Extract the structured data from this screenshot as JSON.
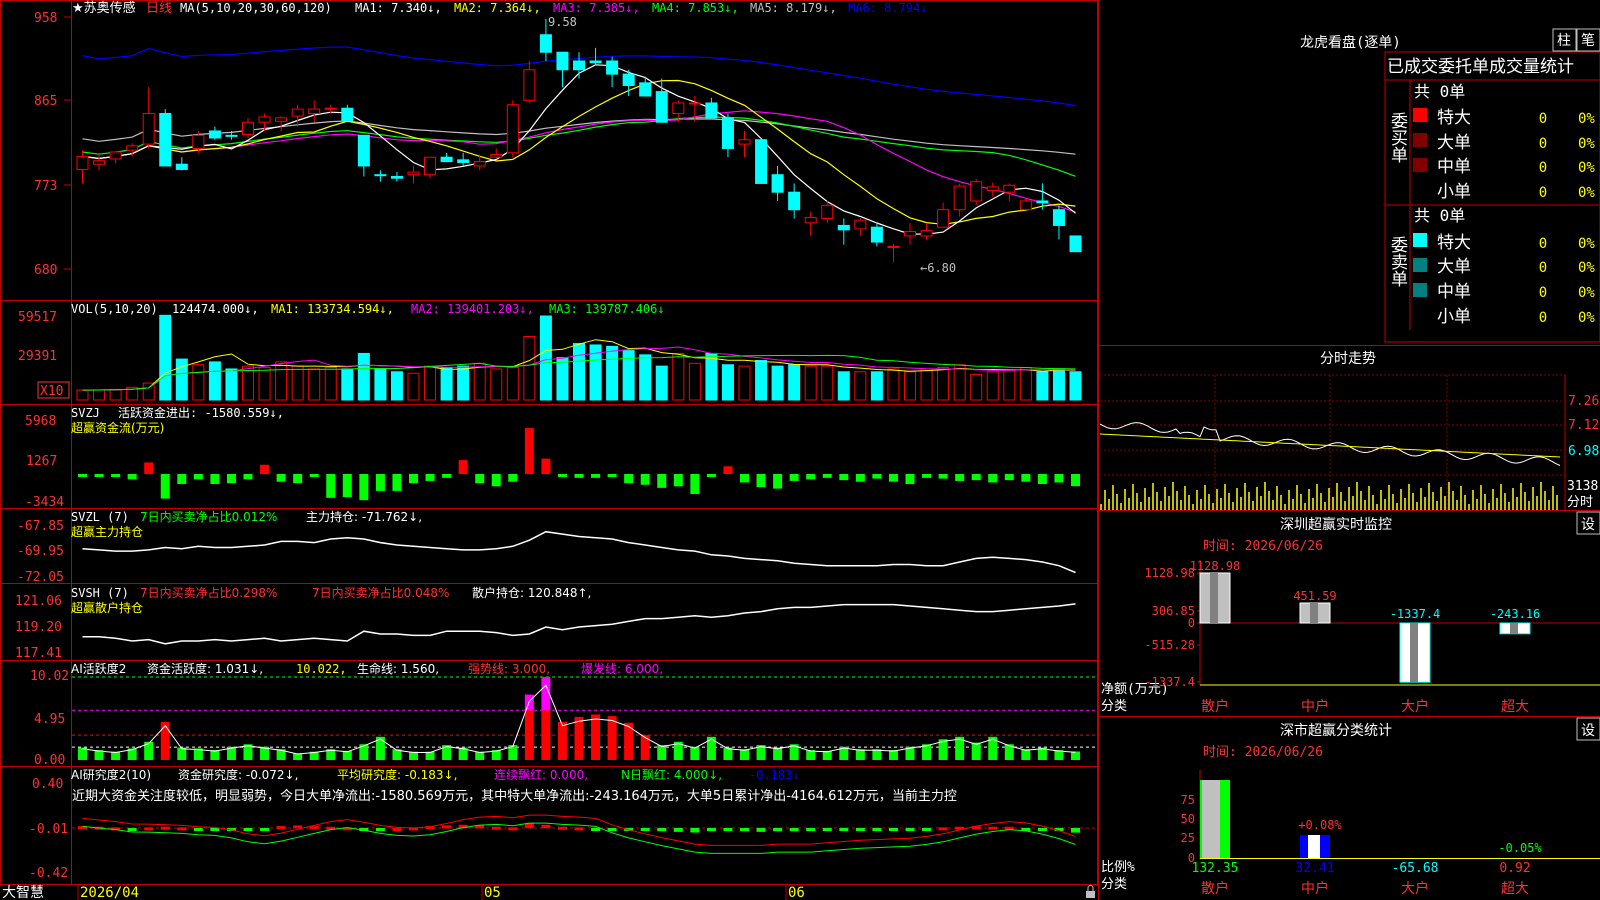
{
  "colors": {
    "up": "#ff0000",
    "down": "#00ffff",
    "axis": "#c00000",
    "grid": "#800000",
    "ma1": "#ffffff",
    "ma2": "#ffff00",
    "ma3": "#ff00ff",
    "ma4": "#00ff00",
    "ma5": "#c0c0c0",
    "ma6": "#0000ff",
    "green": "#00ff00",
    "yellow": "#ffff00",
    "magenta": "#ff00ff",
    "teal": "#008080",
    "darkred": "#800000"
  },
  "header": {
    "stock_name": "★苏奥传感",
    "period": "日线",
    "ma_params": "MA(5,10,20,30,60,120)",
    "ma1": "MA1: 7.340↓,",
    "ma2": "MA2: 7.364↓,",
    "ma3": "MA3: 7.385↓,",
    "ma4": "MA4: 7.853↓,",
    "ma5": "MA5: 8.179↓,",
    "ma6": "MA6: 8.794↓",
    "high_mark": "9.58",
    "low_mark": "←6.80"
  },
  "price_axis": [
    "958",
    "865",
    "773",
    "680"
  ],
  "vol_panel": {
    "title": "VOL(5,10,20)",
    "value": "124474.000↓,",
    "ma1": "MA1: 133734.594↓,",
    "ma2": "MA2: 139401.203↓,",
    "ma3": "MA3: 139787.406↓",
    "axis": [
      "59517",
      "29391"
    ],
    "unit": "X10"
  },
  "svzj_panel": {
    "title": "SVZJ",
    "label": "活跃资金进出: -1580.559↓,",
    "subtitle": "超赢资金流(万元)",
    "axis": [
      "5968",
      "1267",
      "-3434"
    ]
  },
  "svzl_panel": {
    "title": "SVZL (7)",
    "label1": "7日内买卖净占比0.012%",
    "label2": "主力持仓: -71.762↓,",
    "subtitle": "超赢主力持仓",
    "axis": [
      "-67.85",
      "-69.95",
      "-72.05"
    ]
  },
  "svsh_panel": {
    "title": "SVSH (7)",
    "label1": "7日内买卖净占比0.298%",
    "label2": "7日内买卖净占比0.048%",
    "label3": "散户持仓: 120.848↑,",
    "subtitle": "超赢散户持仓",
    "axis": [
      "121.06",
      "119.20",
      "117.41"
    ]
  },
  "ai_active_panel": {
    "title": "AI活跃度2",
    "label1": "资金活跃度: 1.031↓,",
    "label2": "10.022,",
    "label3": "生命线: 1.560,",
    "label4": "强势线: 3.000,",
    "label5": "爆发线: 6.000,",
    "axis": [
      "10.02",
      "4.95",
      "0.00"
    ]
  },
  "ai_research_panel": {
    "title": "AI研究度2(10)",
    "label1": "资金研究度: -0.072↓,",
    "label2": "平均研究度: -0.183↓,",
    "label3": "连续飘红: 0.000,",
    "label4": "N日飘红: 4.000↓,",
    "label5": "-0.183↓",
    "comment": "近期大资金关注度较低，明显弱势，今日大单净流出:-1580.569万元，其中特大单净流出:-243.164万元，大单5日累计净出-4164.612万元，当前主力控",
    "axis": [
      "0.40",
      "-0.01",
      "-0.42"
    ]
  },
  "date_axis": {
    "brand": "大智慧",
    "d1": "2026/04",
    "d2": "05",
    "d3": "06"
  },
  "right_panel": {
    "dragon_title": "龙虎看盘(逐单)",
    "btn_zhu": "柱",
    "btn_bi": "笔",
    "stat_title": "已成交委托单成交量统计",
    "buy_label": "委买单",
    "sell_label": "委卖单",
    "buy_total": "共 0单",
    "sell_total": "共 0单",
    "rows": [
      {
        "label": "特大",
        "count": "0",
        "pct": "0%"
      },
      {
        "label": "大单",
        "count": "0",
        "pct": "0%"
      },
      {
        "label": "中单",
        "count": "0",
        "pct": "0%"
      },
      {
        "label": "小单",
        "count": "0",
        "pct": "0%"
      }
    ],
    "intraday_title": "分时走势",
    "intraday_axis": [
      "7.26",
      "7.12",
      "6.98",
      "3138"
    ],
    "intraday_unit": "分时",
    "sz_monitor_title": "深圳超赢实时监控",
    "sz_btn": "设",
    "sz_time": "时间: 2026/06/26",
    "sz_axis": [
      "1128.98",
      "306.85",
      "0",
      "-515.28",
      "-1337.4"
    ],
    "sz_ylabel": "净额(万元)",
    "sz_xlabel": "分类",
    "sz_categories": [
      "散户",
      "中户",
      "大户",
      "超大"
    ],
    "sz_values": [
      "1128.98",
      "451.59",
      "-1337.4",
      "-243.16"
    ],
    "sc_title": "深市超赢分类统计",
    "sc_btn": "设",
    "sc_time": "时间: 2026/06/26",
    "sc_axis": [
      "75",
      "50",
      "25",
      "0"
    ],
    "sc_ylabel": "比例%",
    "sc_xlabel": "分类",
    "sc_categories": [
      "散户",
      "中户",
      "大户",
      "超大"
    ],
    "sc_values": [
      "132.35",
      "32.41",
      "-65.68",
      "0.92"
    ],
    "sc_bar_labels": [
      "+0.08%",
      "-0.05%"
    ]
  },
  "chart_data": [
    {
      "type": "candlestick",
      "title": "苏奥传感 日线",
      "ylim": [
        6.8,
        9.58
      ],
      "note": "approx daily OHLC read from image",
      "candles": [
        [
          7.86,
          8.08,
          7.7,
          8.01
        ],
        [
          7.92,
          8.05,
          7.85,
          7.96
        ],
        [
          7.98,
          8.07,
          7.93,
          8.06
        ],
        [
          8.08,
          8.16,
          8.01,
          8.13
        ],
        [
          8.15,
          8.8,
          8.1,
          8.5
        ],
        [
          8.5,
          8.55,
          7.98,
          7.9
        ],
        [
          7.92,
          8.0,
          7.85,
          7.86
        ],
        [
          8.1,
          8.3,
          8.05,
          8.25
        ],
        [
          8.3,
          8.35,
          8.2,
          8.22
        ],
        [
          8.25,
          8.3,
          8.2,
          8.24
        ],
        [
          8.26,
          8.45,
          8.22,
          8.4
        ],
        [
          8.4,
          8.5,
          8.3,
          8.46
        ],
        [
          8.41,
          8.47,
          8.3,
          8.45
        ],
        [
          8.47,
          8.6,
          8.35,
          8.55
        ],
        [
          8.5,
          8.65,
          8.4,
          8.55
        ],
        [
          8.55,
          8.6,
          8.5,
          8.56
        ],
        [
          8.56,
          8.6,
          8.4,
          8.42
        ],
        [
          8.25,
          8.25,
          7.78,
          7.9
        ],
        [
          7.8,
          7.85,
          7.72,
          7.79
        ],
        [
          7.78,
          7.83,
          7.72,
          7.76
        ],
        [
          7.8,
          7.9,
          7.7,
          7.83
        ],
        [
          7.8,
          8.0,
          7.76,
          8.0
        ],
        [
          8.0,
          8.05,
          7.95,
          7.95
        ],
        [
          7.97,
          8.05,
          7.9,
          7.94
        ],
        [
          7.9,
          8.03,
          7.85,
          7.95
        ],
        [
          8.0,
          8.1,
          7.98,
          8.03
        ],
        [
          8.05,
          8.65,
          8.0,
          8.6
        ],
        [
          8.65,
          9.1,
          8.62,
          9.0
        ],
        [
          9.4,
          9.58,
          9.1,
          9.2
        ],
        [
          9.2,
          9.2,
          8.8,
          9.0
        ],
        [
          9.1,
          9.2,
          8.9,
          9.0
        ],
        [
          9.1,
          9.25,
          9.05,
          9.08
        ],
        [
          9.1,
          9.15,
          8.8,
          8.95
        ],
        [
          8.95,
          9.0,
          8.7,
          8.82
        ],
        [
          8.85,
          8.92,
          8.7,
          8.7
        ],
        [
          8.75,
          8.9,
          8.4,
          8.4
        ],
        [
          8.5,
          8.65,
          8.4,
          8.62
        ],
        [
          8.62,
          8.7,
          8.4,
          8.62
        ],
        [
          8.62,
          8.68,
          8.45,
          8.45
        ],
        [
          8.45,
          8.5,
          8.0,
          8.1
        ],
        [
          8.15,
          8.3,
          8.0,
          8.2
        ],
        [
          8.2,
          8.22,
          7.7,
          7.7
        ],
        [
          7.8,
          7.9,
          7.5,
          7.6
        ],
        [
          7.6,
          7.7,
          7.3,
          7.4
        ],
        [
          7.25,
          7.38,
          7.1,
          7.31
        ],
        [
          7.3,
          7.5,
          7.25,
          7.45
        ],
        [
          7.22,
          7.3,
          7.0,
          7.17
        ],
        [
          7.18,
          7.3,
          7.1,
          7.28
        ],
        [
          7.2,
          7.25,
          6.98,
          7.03
        ],
        [
          6.98,
          7.01,
          6.8,
          6.98
        ],
        [
          7.1,
          7.25,
          7.0,
          7.15
        ],
        [
          7.1,
          7.25,
          7.05,
          7.16
        ],
        [
          7.2,
          7.48,
          7.2,
          7.4
        ],
        [
          7.4,
          7.7,
          7.32,
          7.67
        ],
        [
          7.5,
          7.75,
          7.45,
          7.72
        ],
        [
          7.62,
          7.71,
          7.55,
          7.66
        ],
        [
          7.6,
          7.7,
          7.5,
          7.68
        ],
        [
          7.4,
          7.53,
          7.4,
          7.5
        ],
        [
          7.5,
          7.7,
          7.4,
          7.48
        ],
        [
          7.4,
          7.45,
          7.06,
          7.22
        ],
        [
          7.1,
          7.1,
          6.92,
          6.92
        ]
      ]
    },
    {
      "type": "bar",
      "title": "VOL(5,10,20)",
      "series": [
        {
          "name": "VOL",
          "values": [
            7000,
            7200,
            7500,
            9000,
            12000,
            60000,
            29000,
            25000,
            27000,
            22000,
            24000,
            23000,
            27000,
            24000,
            22000,
            23000,
            22000,
            33000,
            22000,
            20000,
            19000,
            24000,
            23000,
            24000,
            26000,
            22000,
            23000,
            45000,
            59517,
            30000,
            40000,
            39000,
            38000,
            35000,
            32000,
            24000,
            33000,
            26000,
            33000,
            25000,
            24000,
            28000,
            24000,
            25000,
            24000,
            24000,
            20000,
            20000,
            20000,
            22000,
            20000,
            22000,
            23000,
            25000,
            18000,
            20000,
            21000,
            23000,
            20000,
            22000,
            20000
          ]
        }
      ]
    },
    {
      "type": "bar",
      "title": "SVZJ 超赢资金流(万元)",
      "series": [
        {
          "name": "活跃资金进出",
          "values": [
            -300,
            -300,
            -300,
            -700,
            1500,
            -3200,
            -1300,
            -700,
            -1300,
            -1200,
            -700,
            1200,
            -1000,
            -1200,
            -300,
            -3100,
            -3000,
            -3400,
            -2200,
            -2200,
            -1200,
            -900,
            -500,
            1800,
            -1200,
            -1600,
            -1000,
            5968,
            2000,
            -300,
            -500,
            -500,
            -300,
            -1200,
            -1400,
            -1800,
            -1600,
            -2600,
            -300,
            1000,
            -1100,
            -1700,
            -1900,
            -900,
            -700,
            -500,
            -800,
            -1000,
            -600,
            -1000,
            -1300,
            -500,
            -600,
            -900,
            -800,
            -1100,
            -800,
            -1000,
            -1300,
            -1100,
            -1580
          ]
        }
      ]
    },
    {
      "type": "line",
      "title": "SVZL 超赢主力持仓",
      "ylim": [
        -72.05,
        -67.85
      ],
      "series": [
        {
          "name": "主力持仓",
          "values": [
            -69.8,
            -69.9,
            -70.0,
            -70.0,
            -69.9,
            -69.7,
            -69.8,
            -69.6,
            -69.7,
            -69.7,
            -69.6,
            -69.5,
            -69.2,
            -69.2,
            -69.3,
            -69.0,
            -68.9,
            -69.0,
            -69.3,
            -69.5,
            -69.6,
            -69.7,
            -69.8,
            -69.9,
            -69.9,
            -69.8,
            -69.6,
            -69.1,
            -68.4,
            -68.6,
            -68.8,
            -68.9,
            -69.0,
            -69.3,
            -69.5,
            -69.7,
            -69.9,
            -70.0,
            -70.3,
            -70.4,
            -70.6,
            -70.7,
            -70.8,
            -71.0,
            -71.1,
            -71.2,
            -71.2,
            -71.2,
            -71.2,
            -71.1,
            -71.1,
            -71.2,
            -71.2,
            -70.9,
            -70.6,
            -70.5,
            -70.6,
            -70.7,
            -70.9,
            -71.2,
            -71.76
          ]
        }
      ]
    },
    {
      "type": "line",
      "title": "SVSH 超赢散户持仓",
      "ylim": [
        117.41,
        121.06
      ],
      "series": [
        {
          "name": "散户持仓",
          "values": [
            118.5,
            118.5,
            118.4,
            118.2,
            118.3,
            118.0,
            118.2,
            118.2,
            118.3,
            118.2,
            118.3,
            118.4,
            118.2,
            118.3,
            118.4,
            118.3,
            118.2,
            118.9,
            118.7,
            118.7,
            118.6,
            118.6,
            118.9,
            118.9,
            118.9,
            118.8,
            118.6,
            118.7,
            119.2,
            119.0,
            119.2,
            119.3,
            119.4,
            119.6,
            119.8,
            119.8,
            119.9,
            120.0,
            119.9,
            120.0,
            120.2,
            120.3,
            120.5,
            120.6,
            120.6,
            120.7,
            120.8,
            120.8,
            120.8,
            120.8,
            120.7,
            120.6,
            120.5,
            120.4,
            120.3,
            120.3,
            120.4,
            120.5,
            120.6,
            120.7,
            120.85
          ]
        }
      ]
    },
    {
      "type": "bar",
      "title": "AI活跃度2",
      "series": [
        {
          "name": "资金活跃度",
          "values": [
            1.5,
            1.2,
            1.0,
            1.4,
            2.2,
            4.6,
            1.5,
            1.4,
            1.2,
            1.6,
            1.9,
            1.6,
            1.3,
            0.8,
            1.0,
            1.3,
            1.1,
            1.9,
            2.8,
            1.3,
            1.0,
            1.0,
            1.8,
            1.5,
            1.0,
            1.2,
            1.8,
            7.9,
            10.02,
            4.6,
            5.2,
            5.5,
            5.3,
            4.5,
            3.0,
            1.8,
            2.2,
            1.6,
            2.8,
            1.5,
            1.3,
            1.8,
            1.5,
            1.9,
            1.2,
            1.1,
            1.6,
            1.3,
            1.3,
            1.2,
            1.6,
            1.9,
            2.5,
            2.8,
            2.1,
            2.8,
            1.9,
            1.3,
            1.5,
            1.2,
            1.03
          ]
        }
      ],
      "lines": {
        "生命线": 1.56,
        "强势线": 3.0,
        "爆发线": 6.0
      }
    },
    {
      "type": "bar",
      "title": "AI研究度2(10)",
      "ylim": [
        -0.42,
        0.4
      ],
      "series": [
        {
          "name": "资金研究度",
          "values": [
            0.03,
            0.02,
            0.01,
            -0.01,
            0.01,
            0.02,
            0.01,
            -0.01,
            -0.02,
            -0.03,
            -0.04,
            -0.02,
            0.03,
            0.04,
            0.03,
            0.02,
            0.01,
            -0.01,
            -0.01,
            0.0,
            0.01,
            0.03,
            0.04,
            0.05,
            0.04,
            0.02,
            0.01,
            0.08,
            0.05,
            0.02,
            0.01,
            -0.01,
            -0.02,
            -0.03,
            -0.04,
            -0.05,
            -0.06,
            -0.07,
            -0.05,
            -0.04,
            -0.05,
            -0.06,
            -0.05,
            -0.05,
            -0.04,
            -0.03,
            -0.04,
            -0.03,
            -0.04,
            -0.03,
            -0.02,
            -0.01,
            0.01,
            0.02,
            0.03,
            0.02,
            0.02,
            -0.01,
            -0.03,
            -0.04,
            -0.072
          ]
        }
      ]
    },
    {
      "type": "bar",
      "title": "深圳超赢实时监控",
      "categories": [
        "散户",
        "中户",
        "大户",
        "超大"
      ],
      "series": [
        {
          "name": "净额(万元)",
          "values": [
            1128.98,
            451.59,
            -1337.4,
            -243.16
          ]
        }
      ]
    },
    {
      "type": "bar",
      "title": "深市超赢分类统计",
      "categories": [
        "散户",
        "中户",
        "大户",
        "超大"
      ],
      "series": [
        {
          "name": "比例%",
          "values": [
            132.35,
            32.41,
            -65.68,
            0.92
          ]
        }
      ]
    }
  ]
}
